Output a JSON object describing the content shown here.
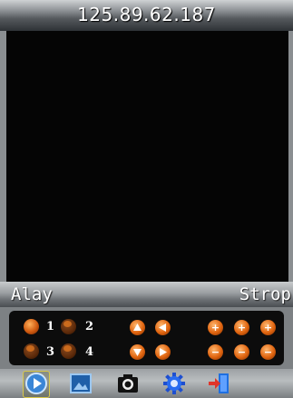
{
  "header": {
    "title": "125.89.62.187"
  },
  "status": {
    "left": "Alay",
    "right": "Strop"
  },
  "channels": [
    {
      "number": "1",
      "active": true
    },
    {
      "number": "2",
      "active": false
    },
    {
      "number": "3",
      "active": false
    },
    {
      "number": "4",
      "active": false
    }
  ],
  "ptz": {
    "up_icon": "arrow-up-icon",
    "left_icon": "arrow-left-icon",
    "down_icon": "arrow-down-icon",
    "right_icon": "arrow-right-icon"
  },
  "adjust": {
    "plus": [
      "+",
      "+",
      "+"
    ],
    "minus": [
      "−",
      "−",
      "−"
    ]
  },
  "toolbar": {
    "items": [
      "play-icon",
      "image-icon",
      "camera-icon",
      "gear-icon",
      "exit-icon"
    ]
  },
  "colors": {
    "accent": "#e0640f",
    "frame": "#8a8e91"
  }
}
